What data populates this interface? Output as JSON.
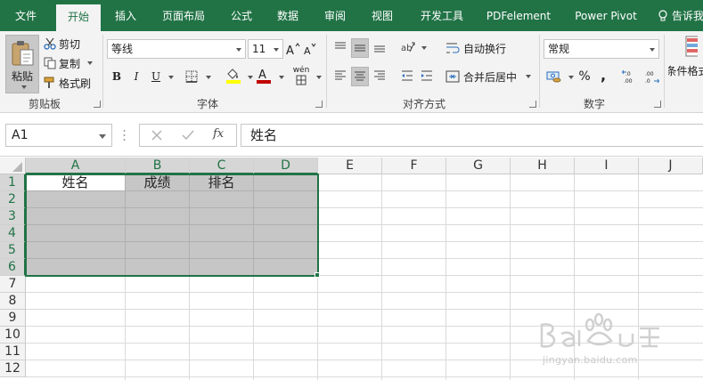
{
  "tabs": [
    {
      "label": "文件",
      "active": false
    },
    {
      "label": "开始",
      "active": true
    },
    {
      "label": "插入",
      "active": false
    },
    {
      "label": "页面布局",
      "active": false
    },
    {
      "label": "公式",
      "active": false
    },
    {
      "label": "数据",
      "active": false
    },
    {
      "label": "审阅",
      "active": false
    },
    {
      "label": "视图",
      "active": false
    },
    {
      "label": "开发工具",
      "active": false
    },
    {
      "label": "PDFelement",
      "active": false
    },
    {
      "label": "Power Pivot",
      "active": false
    }
  ],
  "tell_me": "告诉我",
  "clipboard": {
    "paste": "粘贴",
    "cut": "剪切",
    "copy": "复制",
    "format_painter": "格式刷",
    "group_label": "剪贴板"
  },
  "font": {
    "family": "等线",
    "size": "11",
    "bold": "B",
    "italic": "I",
    "underline": "U",
    "phonetic": "wén",
    "group_label": "字体"
  },
  "alignment": {
    "wrap_text": "自动换行",
    "merge_center": "合并后居中",
    "group_label": "对齐方式"
  },
  "number": {
    "format": "常规",
    "percent": "%",
    "comma": ",",
    "group_label": "数字"
  },
  "styles": {
    "conditional_format": "条件格式"
  },
  "formula_bar": {
    "name_box": "A1",
    "content": "姓名",
    "fx": "fx"
  },
  "grid": {
    "columns": [
      "A",
      "B",
      "C",
      "D",
      "E",
      "F",
      "G",
      "H",
      "I",
      "J"
    ],
    "rows": [
      "1",
      "2",
      "3",
      "4",
      "5",
      "6",
      "7",
      "8",
      "9",
      "10",
      "11",
      "12"
    ],
    "selected_columns": [
      "A",
      "B",
      "C",
      "D"
    ],
    "selected_rows": [
      "1",
      "2",
      "3",
      "4",
      "5",
      "6"
    ],
    "cells": {
      "A1": "姓名",
      "B1": "成绩",
      "C1": "排名"
    }
  },
  "watermark": {
    "url": "jingyan.baidu.com"
  },
  "colors": {
    "accent": "#217346",
    "selection_fill": "#c6c6c6"
  }
}
